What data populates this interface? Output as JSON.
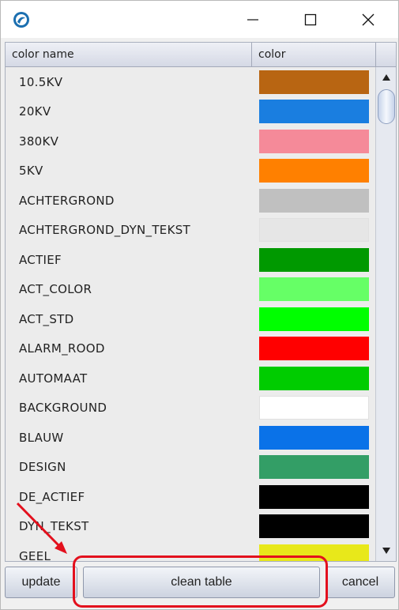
{
  "window": {
    "app_icon": "app-logo-icon",
    "controls": {
      "minimize": "minimize-icon",
      "maximize": "maximize-icon",
      "close": "close-icon"
    }
  },
  "table": {
    "headers": {
      "name": "color name",
      "color": "color"
    },
    "rows": [
      {
        "name": "10.5KV",
        "color": "#b86512"
      },
      {
        "name": "20KV",
        "color": "#1a7ee0"
      },
      {
        "name": "380KV",
        "color": "#f58a99"
      },
      {
        "name": "5KV",
        "color": "#ff8000"
      },
      {
        "name": "ACHTERGROND",
        "color": "#c0c0c0"
      },
      {
        "name": "ACHTERGROND_DYN_TEKST",
        "color": "#e6e6e6"
      },
      {
        "name": "ACTIEF",
        "color": "#009900"
      },
      {
        "name": "ACT_COLOR",
        "color": "#66ff66"
      },
      {
        "name": "ACT_STD",
        "color": "#00ff00"
      },
      {
        "name": "ALARM_ROOD",
        "color": "#ff0000"
      },
      {
        "name": "AUTOMAAT",
        "color": "#00cc00"
      },
      {
        "name": "BACKGROUND",
        "color": "#ffffff"
      },
      {
        "name": "BLAUW",
        "color": "#0a72e8"
      },
      {
        "name": "DESIGN",
        "color": "#339e66"
      },
      {
        "name": "DE_ACTIEF",
        "color": "#000000"
      },
      {
        "name": "DYN_TEKST",
        "color": "#000000"
      },
      {
        "name": "GEEL",
        "color": "#e8e81a"
      }
    ]
  },
  "scrollbar": {
    "up": "scroll-up-icon",
    "down": "scroll-down-icon"
  },
  "buttons": {
    "update": "update",
    "clean_table": "clean table",
    "cancel": "cancel"
  },
  "annotation": {
    "highlight_color": "#e3101d"
  }
}
